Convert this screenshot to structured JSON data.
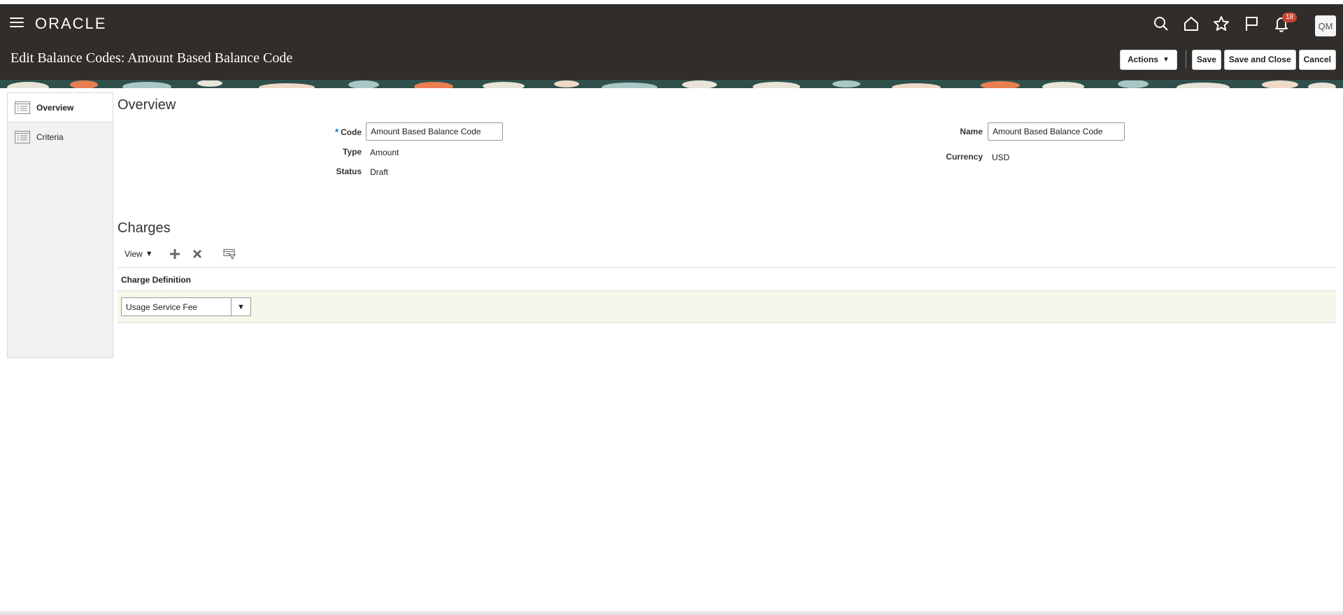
{
  "header": {
    "logo": "ORACLE",
    "page_title": "Edit Balance Codes: Amount Based Balance Code",
    "notification_count": "18",
    "avatar_initials": "QM",
    "buttons": {
      "actions": "Actions",
      "save": "Save",
      "save_and_close": "Save and Close",
      "cancel": "Cancel"
    }
  },
  "nav": {
    "items": [
      {
        "label": "Overview",
        "active": true
      },
      {
        "label": "Criteria",
        "active": false
      }
    ]
  },
  "overview": {
    "title": "Overview",
    "fields": {
      "code_label": "Code",
      "code_value": "Amount Based Balance Code",
      "type_label": "Type",
      "type_value": "Amount",
      "status_label": "Status",
      "status_value": "Draft",
      "name_label": "Name",
      "name_value": "Amount Based Balance Code",
      "currency_label": "Currency",
      "currency_value": "USD"
    }
  },
  "charges": {
    "title": "Charges",
    "view_label": "View",
    "column_header": "Charge Definition",
    "rows": [
      {
        "charge_definition": "Usage Service Fee"
      }
    ]
  },
  "colors": {
    "header_bg": "#312d2a",
    "required_marker": "#0572ce",
    "badge": "#c74634",
    "selected_row": "#f5f7ea"
  }
}
